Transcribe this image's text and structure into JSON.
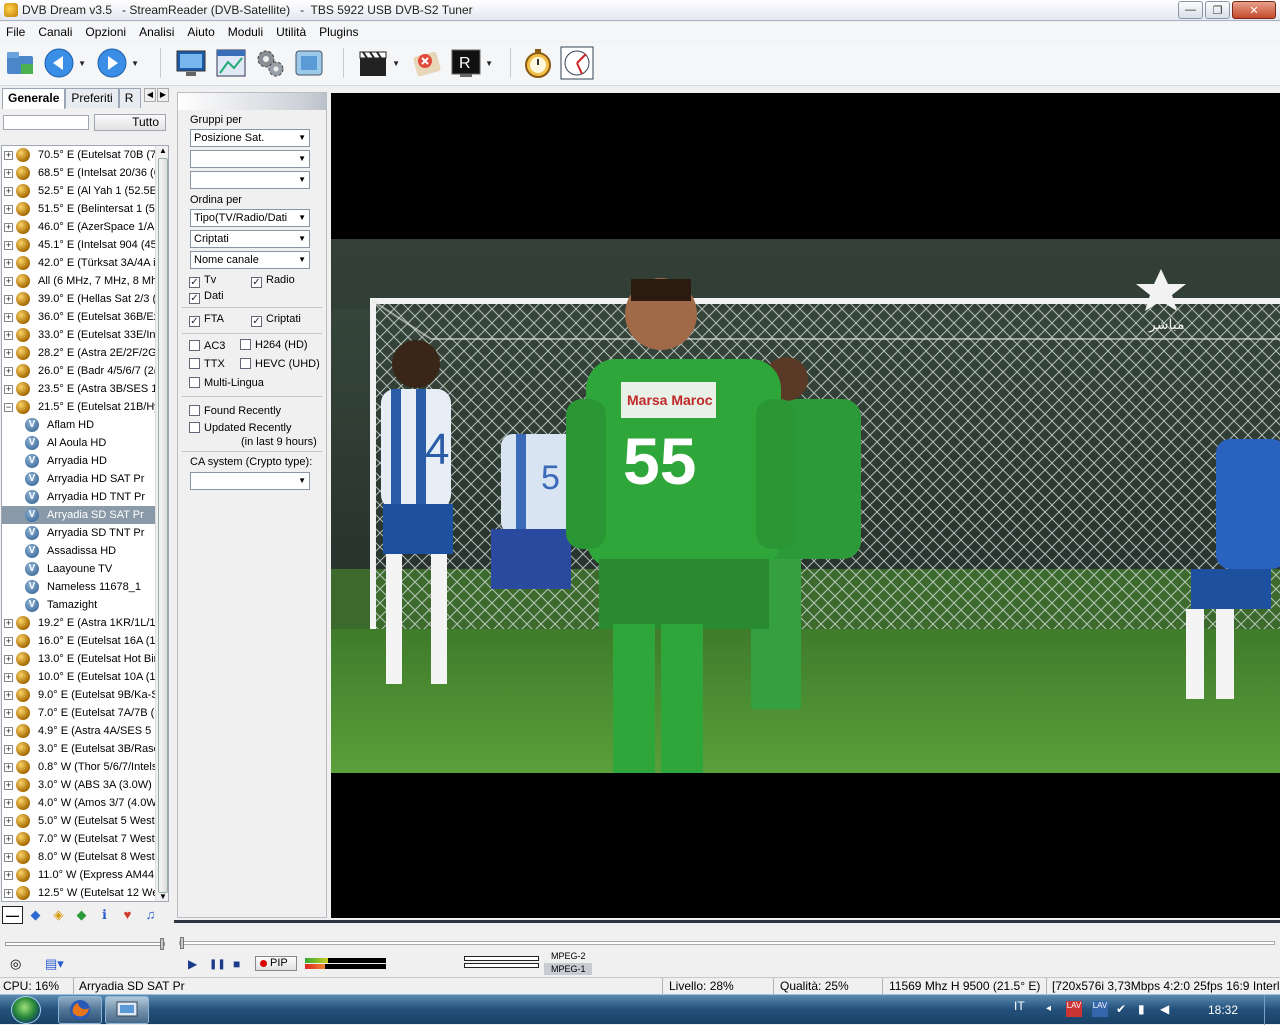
{
  "window": {
    "title": "DVB Dream v3.5   - StreamReader (DVB-Satellite)   -  TBS 5922 USB DVB-S2 Tuner",
    "controls": {
      "minimize": "—",
      "maximize": "❐",
      "close": "✕"
    }
  },
  "menu": [
    "File",
    "Canali",
    "Opzioni",
    "Analisi",
    "Aiuto",
    "Moduli",
    "Utilità",
    "Plugins"
  ],
  "toolbar": {
    "icons": [
      "open-folder-icon",
      "back-icon",
      "forward-icon",
      "monitor-icon",
      "epg-window-icon",
      "settings-gears-icon",
      "screenshot-icon",
      "clapperboard-icon",
      "stop-record-icon",
      "teletext-R-icon",
      "stopwatch-icon",
      "time-shift-icon"
    ]
  },
  "left_panel": {
    "tabs": [
      "Generale",
      "Preferiti",
      "R"
    ],
    "search_value": "",
    "all_button": "Tutto",
    "tree": [
      {
        "type": "sat",
        "label": "70.5° E (Eutelsat 70B (7"
      },
      {
        "type": "sat",
        "label": "68.5° E (Intelsat 20/36 (6"
      },
      {
        "type": "sat",
        "label": "52.5° E (Al Yah 1 (52.5E"
      },
      {
        "type": "sat",
        "label": "51.5° E (Belintersat 1 (5"
      },
      {
        "type": "sat",
        "label": "46.0° E (AzerSpace 1/A"
      },
      {
        "type": "sat",
        "label": "45.1° E (Intelsat 904 (45"
      },
      {
        "type": "sat",
        "label": "42.0° E (Türksat 3A/4A i"
      },
      {
        "type": "sat",
        "label": "All (6 MHz, 7 MHz, 8 Mh"
      },
      {
        "type": "sat",
        "label": "39.0° E (Hellas Sat 2/3 ("
      },
      {
        "type": "sat",
        "label": "36.0° E (Eutelsat 36B/Ex"
      },
      {
        "type": "sat",
        "label": "33.0° E (Eutelsat 33E/Int"
      },
      {
        "type": "sat",
        "label": "28.2° E (Astra 2E/2F/2G"
      },
      {
        "type": "sat",
        "label": "26.0° E (Badr 4/5/6/7 (2("
      },
      {
        "type": "sat",
        "label": "23.5° E (Astra 3B/SES 1"
      },
      {
        "type": "sat",
        "label": "21.5° E (Eutelsat 21B/Hy",
        "expanded": true
      },
      {
        "type": "ch",
        "label": "Aflam HD"
      },
      {
        "type": "ch",
        "label": "Al Aoula HD"
      },
      {
        "type": "ch",
        "label": "Arryadia HD"
      },
      {
        "type": "ch",
        "label": "Arryadia HD SAT Pr"
      },
      {
        "type": "ch",
        "label": "Arryadia HD TNT Pr"
      },
      {
        "type": "ch",
        "label": "Arryadia SD SAT Pr",
        "selected": true
      },
      {
        "type": "ch",
        "label": "Arryadia SD TNT Pr"
      },
      {
        "type": "ch",
        "label": "Assadissa HD"
      },
      {
        "type": "ch",
        "label": "Laayoune TV"
      },
      {
        "type": "ch",
        "label": "Nameless 11678_1"
      },
      {
        "type": "ch",
        "label": "Tamazight"
      },
      {
        "type": "sat",
        "label": "19.2° E (Astra 1KR/1L/1"
      },
      {
        "type": "sat",
        "label": "16.0° E (Eutelsat 16A (1("
      },
      {
        "type": "sat",
        "label": "13.0° E (Eutelsat Hot Bir"
      },
      {
        "type": "sat",
        "label": "10.0° E (Eutelsat 10A (1"
      },
      {
        "type": "sat",
        "label": "9.0° E (Eutelsat 9B/Ka-S"
      },
      {
        "type": "sat",
        "label": "7.0° E (Eutelsat 7A/7B ("
      },
      {
        "type": "sat",
        "label": "4.9° E (Astra 4A/SES 5"
      },
      {
        "type": "sat",
        "label": "3.0° E (Eutelsat 3B/Rasc"
      },
      {
        "type": "sat",
        "label": "0.8° W (Thor 5/6/7/Intels"
      },
      {
        "type": "sat",
        "label": "3.0° W (ABS 3A (3.0W)"
      },
      {
        "type": "sat",
        "label": "4.0° W (Amos 3/7 (4.0W"
      },
      {
        "type": "sat",
        "label": "5.0° W (Eutelsat 5 West"
      },
      {
        "type": "sat",
        "label": "7.0° W (Eutelsat 7 West"
      },
      {
        "type": "sat",
        "label": "8.0° W (Eutelsat 8 West"
      },
      {
        "type": "sat",
        "label": "11.0° W (Express AM44"
      },
      {
        "type": "sat",
        "label": "12.5° W (Eutelsat 12 We"
      }
    ],
    "bottom_icons": [
      "collapse-icon",
      "diamond-blue-icon",
      "face-icon",
      "green-diamond-icon",
      "info-icon",
      "hearts-icon",
      "mask-icon"
    ]
  },
  "filter_panel": {
    "group_by_label": "Gruppi per",
    "group_by": [
      "Posizione Sat.",
      "",
      ""
    ],
    "order_by_label": "Ordina per",
    "order_by": [
      "Tipo(TV/Radio/Dati",
      "Criptati",
      "Nome canale"
    ],
    "checks": {
      "tv": {
        "label": "Tv",
        "checked": true
      },
      "radio": {
        "label": "Radio",
        "checked": true
      },
      "data": {
        "label": "Dati",
        "checked": true
      },
      "fta": {
        "label": "FTA",
        "checked": true
      },
      "crypted": {
        "label": "Criptati",
        "checked": true
      },
      "ac3": {
        "label": "AC3",
        "checked": false
      },
      "h264": {
        "label": "H264 (HD)",
        "checked": false
      },
      "ttx": {
        "label": "TTX",
        "checked": false
      },
      "hevc": {
        "label": "HEVC (UHD)",
        "checked": false
      },
      "multilang": {
        "label": "Multi-Lingua",
        "checked": false
      },
      "found_recently": {
        "label": "Found Recently",
        "checked": false
      },
      "updated_recently": {
        "label": "Updated Recently",
        "checked": false
      }
    },
    "updated_note": "(in last 9 hours)",
    "ca_label": "CA system (Crypto type):",
    "ca_value": ""
  },
  "video": {
    "channel_logo_text": "مباشر",
    "jersey_numbers": [
      "4",
      "55",
      "5"
    ],
    "sponsor_text": "Marsa Maroc"
  },
  "controls": {
    "play": "▶",
    "pause": "❚❚",
    "stop": "■",
    "pip_label": "PIP",
    "level_fraction": 0.28,
    "quality_fraction": 0.25,
    "codecs": [
      "MPEG-2",
      "MPEG-1"
    ]
  },
  "status_bar": {
    "cpu": "CPU: 16%",
    "channel": "Arryadia SD SAT Pr",
    "level": "Livello: 28%",
    "quality": "Qualità: 25%",
    "frequency": "11569 Mhz  H  9500  (21.5° E)",
    "stream_info": "[720x576i  3,73Mbps 4:2:0 25fps 16:9 Interlac"
  },
  "taskbar": {
    "apps": [
      "firefox-icon",
      "dvb-dream-icon"
    ],
    "lang": "IT",
    "clock": "18:32"
  }
}
